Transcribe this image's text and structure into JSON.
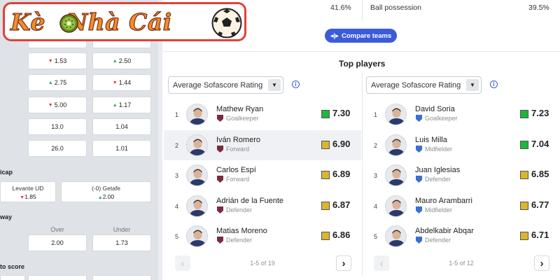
{
  "brand": {
    "text": "Kè Nhà Cái"
  },
  "possession": {
    "home_value": "41.6%",
    "label": "Ball possession",
    "away_value": "39.5%"
  },
  "compare_button": {
    "label": "Compare teams",
    "icon": "compare-icon"
  },
  "odds_rows": [
    {
      "left": {
        "value": "1.53",
        "trend": "down"
      },
      "right": {
        "value": "2.50",
        "trend": "up"
      }
    },
    {
      "left": {
        "value": "2.75",
        "trend": "up"
      },
      "right": {
        "value": "1.44",
        "trend": "down"
      }
    },
    {
      "left": {
        "value": "5.00",
        "trend": "down"
      },
      "right": {
        "value": "1.17",
        "trend": "up"
      }
    },
    {
      "left": {
        "value": "13.0",
        "trend": "none"
      },
      "right": {
        "value": "1.04",
        "trend": "none"
      }
    },
    {
      "left": {
        "value": "26.0",
        "trend": "none"
      },
      "right": {
        "value": "1.01",
        "trend": "none"
      }
    }
  ],
  "handicap": {
    "label": "icap",
    "home": {
      "team": "Levante UD",
      "value": "1.85",
      "trend": "down"
    },
    "away": {
      "team": "(-0) Getafe",
      "value": "2.00",
      "trend": "up"
    }
  },
  "way": {
    "label": "way",
    "over_label": "Over",
    "under_label": "Under",
    "over_value": "2.00",
    "under_value": "1.73"
  },
  "to_score": {
    "label": "to score"
  },
  "top_players": {
    "title": "Top players",
    "home": {
      "select_label": "Average Sofascore Rating",
      "pager_text": "1-5 of 19",
      "players": [
        {
          "rank": "1",
          "name": "Mathew Ryan",
          "position": "Goalkeeper",
          "rating": "7.30",
          "rating_color": "#1db73f"
        },
        {
          "rank": "2",
          "name": "Iván Romero",
          "position": "Forward",
          "rating": "6.90",
          "rating_color": "#d9b62d"
        },
        {
          "rank": "3",
          "name": "Carlos Espí",
          "position": "Forward",
          "rating": "6.89",
          "rating_color": "#d9b62d"
        },
        {
          "rank": "4",
          "name": "Adrián de la Fuente",
          "position": "Defender",
          "rating": "6.87",
          "rating_color": "#d9b62d"
        },
        {
          "rank": "5",
          "name": "Matias Moreno",
          "position": "Defender",
          "rating": "6.86",
          "rating_color": "#d9b62d"
        }
      ]
    },
    "away": {
      "select_label": "Average Sofascore Rating",
      "pager_text": "1-5 of 12",
      "players": [
        {
          "rank": "1",
          "name": "David Soria",
          "position": "Goalkeeper",
          "rating": "7.23",
          "rating_color": "#1db73f"
        },
        {
          "rank": "2",
          "name": "Luis Milla",
          "position": "Midfielder",
          "rating": "7.04",
          "rating_color": "#1db73f"
        },
        {
          "rank": "3",
          "name": "Juan Iglesias",
          "position": "Defender",
          "rating": "6.85",
          "rating_color": "#d9b62d"
        },
        {
          "rank": "4",
          "name": "Mauro Arambarri",
          "position": "Midfielder",
          "rating": "6.77",
          "rating_color": "#d9b62d"
        },
        {
          "rank": "5",
          "name": "Abdelkabir Abqar",
          "position": "Defender",
          "rating": "6.71",
          "rating_color": "#d9b62d"
        }
      ]
    }
  },
  "colors": {
    "accent": "#3b5bdb",
    "rating_green": "#1db73f",
    "rating_yellow": "#d9b62d",
    "odds_up": "#2eaa56",
    "odds_down": "#d53a3a",
    "logo_border": "#e0413a",
    "logo_text": "#f28d2c"
  }
}
